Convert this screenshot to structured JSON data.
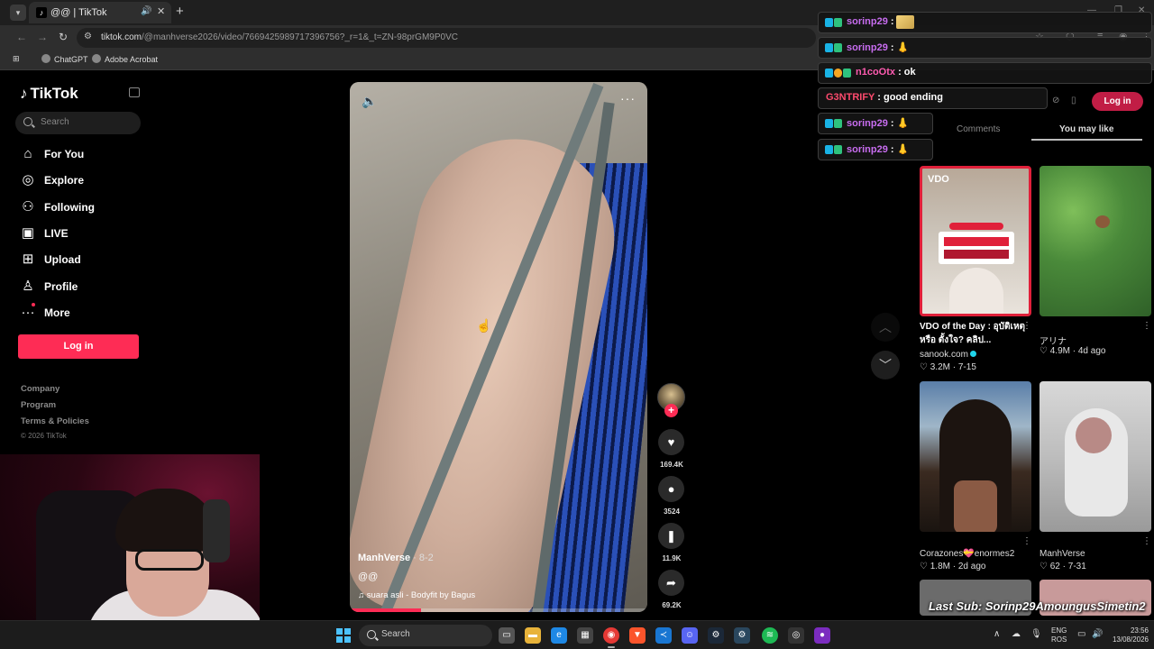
{
  "browser": {
    "tab_title": "@@ | TikTok",
    "tab_icon_glyph": "♪",
    "url_host": "tiktok.com",
    "url_path": "/@manhverse2026/video/7669425989717396756?_r=1&_t=ZN-98prGM9P0VC",
    "bookmarks": [
      "ChatGPT",
      "Adobe Acrobat"
    ]
  },
  "sidebar": {
    "logo": "TikTok",
    "search_placeholder": "Search",
    "nav": [
      {
        "label": "For You",
        "icon": "home-icon",
        "glyph": "⌂"
      },
      {
        "label": "Explore",
        "icon": "compass-icon",
        "glyph": "◎"
      },
      {
        "label": "Following",
        "icon": "following-icon",
        "glyph": "⚇"
      },
      {
        "label": "LIVE",
        "icon": "live-icon",
        "glyph": "▣"
      },
      {
        "label": "Upload",
        "icon": "upload-icon",
        "glyph": "⊞"
      },
      {
        "label": "Profile",
        "icon": "profile-icon",
        "glyph": "♙"
      },
      {
        "label": "More",
        "icon": "more-icon",
        "glyph": "···"
      }
    ],
    "login_label": "Log in",
    "footer": [
      "Company",
      "Program",
      "Terms & Policies"
    ],
    "copyright": "© 2026 TikTok"
  },
  "video": {
    "author": "ManhVerse",
    "date": " · 8-2",
    "caption": "@@",
    "music_icon": "♫",
    "music": "suara asli - Bodyfit by Bagus",
    "progress_percent": 24,
    "likes": "169.4K",
    "comments": "3524",
    "saves": "11.9K",
    "shares": "69.2K"
  },
  "chat": [
    {
      "user": "sorinp29",
      "sep": " : ",
      "msg": "",
      "color": "#c86df0",
      "badges": 2,
      "emoji": "img"
    },
    {
      "user": "sorinp29",
      "sep": " : ",
      "msg": "👃",
      "color": "#c86df0",
      "badges": 2
    },
    {
      "user": "n1coOtx",
      "sep": " : ",
      "msg": "ok",
      "color": "#ff5bb0",
      "badges": 3
    },
    {
      "user": "G3NTRIFY",
      "sep": " : ",
      "msg": "good ending",
      "color": "#ff4b6e",
      "badges": 0
    },
    {
      "user": "sorinp29",
      "sep": " : ",
      "msg": "👃",
      "color": "#c86df0",
      "badges": 2
    },
    {
      "user": "sorinp29",
      "sep": " : ",
      "msg": "👃",
      "color": "#c86df0",
      "badges": 2
    }
  ],
  "panel": {
    "login_label": "Log in",
    "tabs": [
      "Comments",
      "You may like"
    ],
    "active_tab": "You may like"
  },
  "recommendations": [
    {
      "title": "VDO of the Day : อุบัติเหตุ หรือ ตั้งใจ? คลิป...",
      "author": "sanook.com",
      "verified": true,
      "stats": "♡ 3.2M · 7-15",
      "thumb_label": "VDO"
    },
    {
      "title": "",
      "author": "アリナ",
      "verified": false,
      "stats": "♡ 4.9M · 4d ago"
    },
    {
      "title": "",
      "author": "Corazones💝enormes2",
      "verified": false,
      "stats": "♡ 1.8M · 2d ago"
    },
    {
      "title": "",
      "author": "ManhVerse",
      "verified": false,
      "stats": "♡ 62 · 7-31"
    }
  ],
  "stream_overlay": {
    "last_sub": "Last Sub: Sorinp29AmoungusSimetin2"
  },
  "taskbar": {
    "search_label": "Search",
    "lang_top": "ENG",
    "lang_bottom": "ROS",
    "time": "23:56",
    "date": "13/08/2026"
  }
}
